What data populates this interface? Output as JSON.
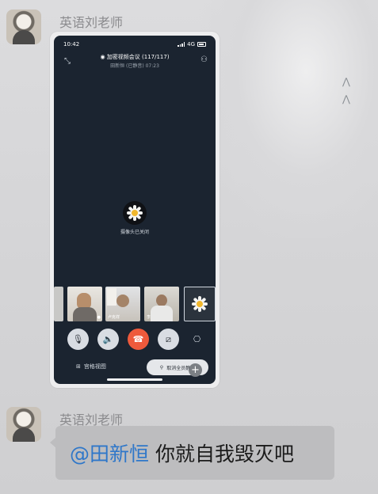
{
  "messages": [
    {
      "sender": "英语刘老师",
      "type": "image",
      "screenshot": {
        "status": {
          "time": "10:42",
          "network": "4G"
        },
        "meeting": {
          "title": "加密视频会议 (117/117)",
          "subtitle": "田新恒 (已静音) 07:23",
          "camera_off_label": "摄像头已关闭"
        },
        "participants": [
          {
            "name": ""
          },
          {
            "name": ""
          },
          {
            "name": "卢克祥"
          },
          {
            "name": "李静超"
          },
          {
            "name": ""
          }
        ],
        "bottom": {
          "grid_view_label": "宫格视图",
          "unmute_all_label": "取消全员静音"
        }
      }
    },
    {
      "sender": "英语刘老师",
      "type": "text",
      "mention": "@田新恒",
      "text": "你就自我毁灭吧"
    }
  ],
  "colors": {
    "chat_bg": "#d8d8da",
    "bubble": "#bdbdbf",
    "mention": "#2f77c9",
    "meeting_bg": "#1b2430",
    "hangup": "#ee5a3c"
  }
}
